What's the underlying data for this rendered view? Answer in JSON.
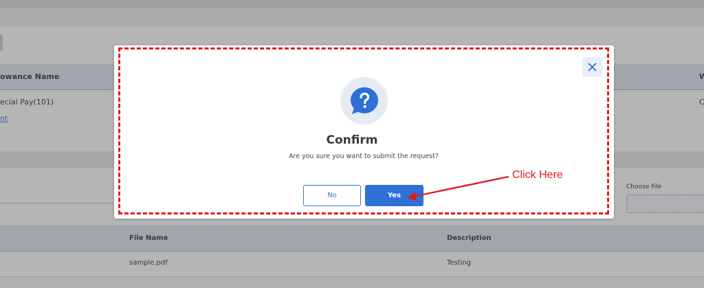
{
  "background": {
    "table1": {
      "header_col1": "owance Name",
      "header_col_right": "W",
      "row1_col1": "ecial Pay(101)",
      "row1_col_right": "C",
      "link_fragment": "nt"
    },
    "choose_file_label": "Choose File",
    "table2": {
      "headers": [
        "File Name",
        "Description"
      ],
      "rows": [
        {
          "file_name": "sample.pdf",
          "description": "Testing"
        }
      ]
    }
  },
  "modal": {
    "close_symbol": "✕",
    "title": "Confirm",
    "message": "Are you sure you want to submit the request?",
    "no_label": "No",
    "yes_label": "Yes",
    "icon": "question-chat-icon"
  },
  "annotation": {
    "text": "Click Here",
    "color": "#e3191e"
  },
  "colors": {
    "primary": "#2e6fd8",
    "annotation_red": "#e3191e"
  }
}
